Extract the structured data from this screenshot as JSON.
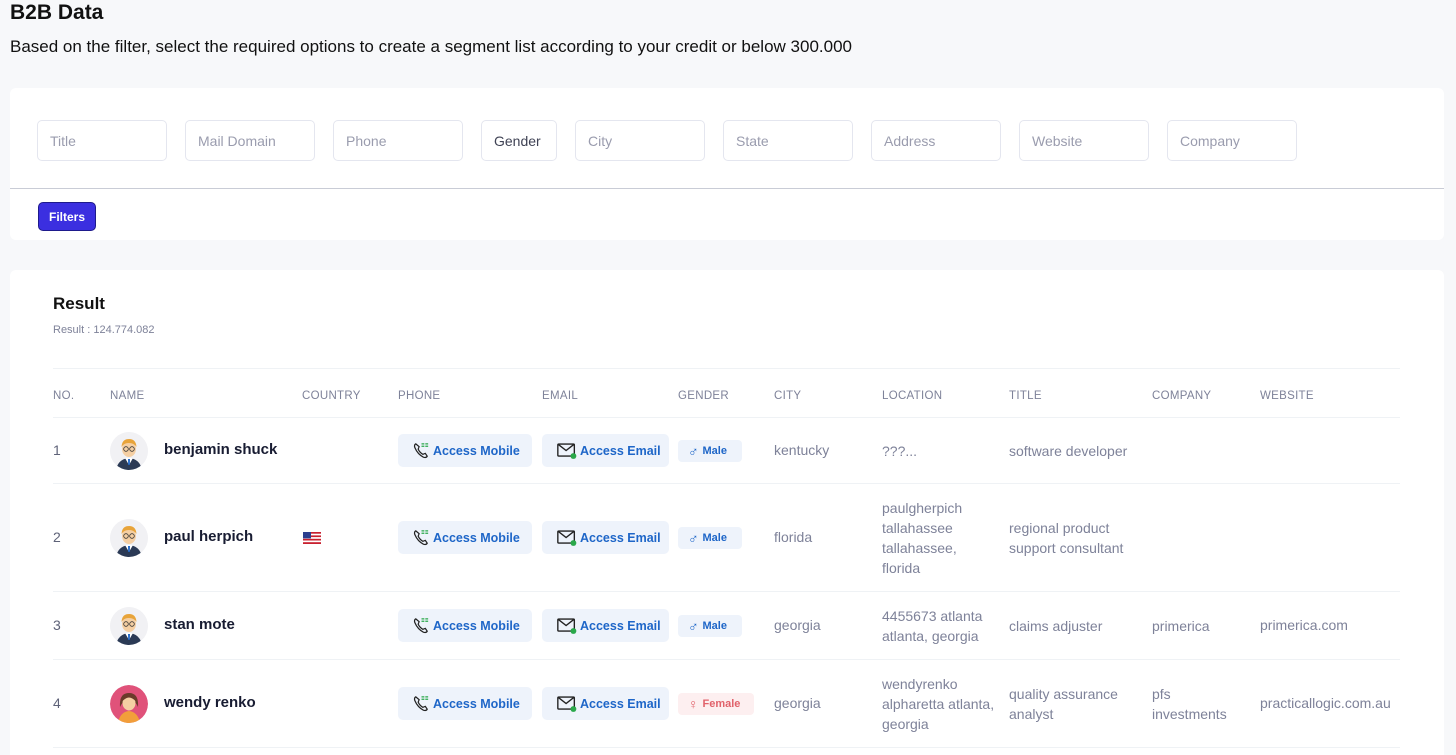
{
  "page": {
    "title": "B2B Data",
    "subtitle": "Based on the filter, select the required options to create a segment list according to your credit or below 300.000"
  },
  "filters": {
    "title_placeholder": "Title",
    "mail_domain_placeholder": "Mail Domain",
    "phone_placeholder": "Phone",
    "gender_label": "Gender",
    "city_placeholder": "City",
    "state_placeholder": "State",
    "address_placeholder": "Address",
    "website_placeholder": "Website",
    "company_placeholder": "Company",
    "filters_button": "Filters"
  },
  "result": {
    "title": "Result",
    "count": "Result : 124.774.082"
  },
  "table": {
    "columns": [
      "NO.",
      "NAME",
      "COUNTRY",
      "PHONE",
      "EMAIL",
      "GENDER",
      "CITY",
      "LOCATION",
      "TITLE",
      "COMPANY",
      "WEBSITE"
    ],
    "rows": [
      {
        "no": "1",
        "name": "benjamin shuck",
        "country": "",
        "country_icon": "",
        "phone": "Access Mobile",
        "email": "Access Email",
        "gender": "Male",
        "city": "kentucky",
        "location": [
          "???..."
        ],
        "title": [
          "software developer"
        ],
        "company": [],
        "website": "",
        "avatar": "male-avatar-icon"
      },
      {
        "no": "2",
        "name": "paul herpich",
        "country": "",
        "country_icon": "us-flag-icon",
        "phone": "Access Mobile",
        "email": "Access Email",
        "gender": "Male",
        "city": "florida",
        "location": [
          "paulgherpich",
          "tallahassee",
          "tallahassee,",
          "florida"
        ],
        "title": [
          "regional product",
          "support consultant"
        ],
        "company": [],
        "website": "",
        "avatar": "male-avatar-icon"
      },
      {
        "no": "3",
        "name": "stan mote",
        "country": "",
        "country_icon": "",
        "phone": "Access Mobile",
        "email": "Access Email",
        "gender": "Male",
        "city": "georgia",
        "location": [
          "4455673 atlanta",
          "atlanta, georgia"
        ],
        "title": [
          "claims adjuster"
        ],
        "company": [
          "primerica"
        ],
        "website": "primerica.com",
        "avatar": "male-avatar-icon"
      },
      {
        "no": "4",
        "name": "wendy renko",
        "country": "",
        "country_icon": "",
        "phone": "Access Mobile",
        "email": "Access Email",
        "gender": "Female",
        "city": "georgia",
        "location": [
          "wendyrenko",
          "alpharetta atlanta,",
          "georgia"
        ],
        "title": [
          "quality assurance",
          "analyst"
        ],
        "company": [
          "pfs",
          "investments"
        ],
        "website": "practicallogic.com.au",
        "avatar": "female-avatar-icon"
      }
    ]
  },
  "colors": {
    "primary_button": "#3b2fe0",
    "badge_blue_text": "#1e66c8",
    "badge_blue_bg": "#eef3fb",
    "female_badge_text": "#e1626b",
    "female_badge_bg": "#fdeff0"
  }
}
